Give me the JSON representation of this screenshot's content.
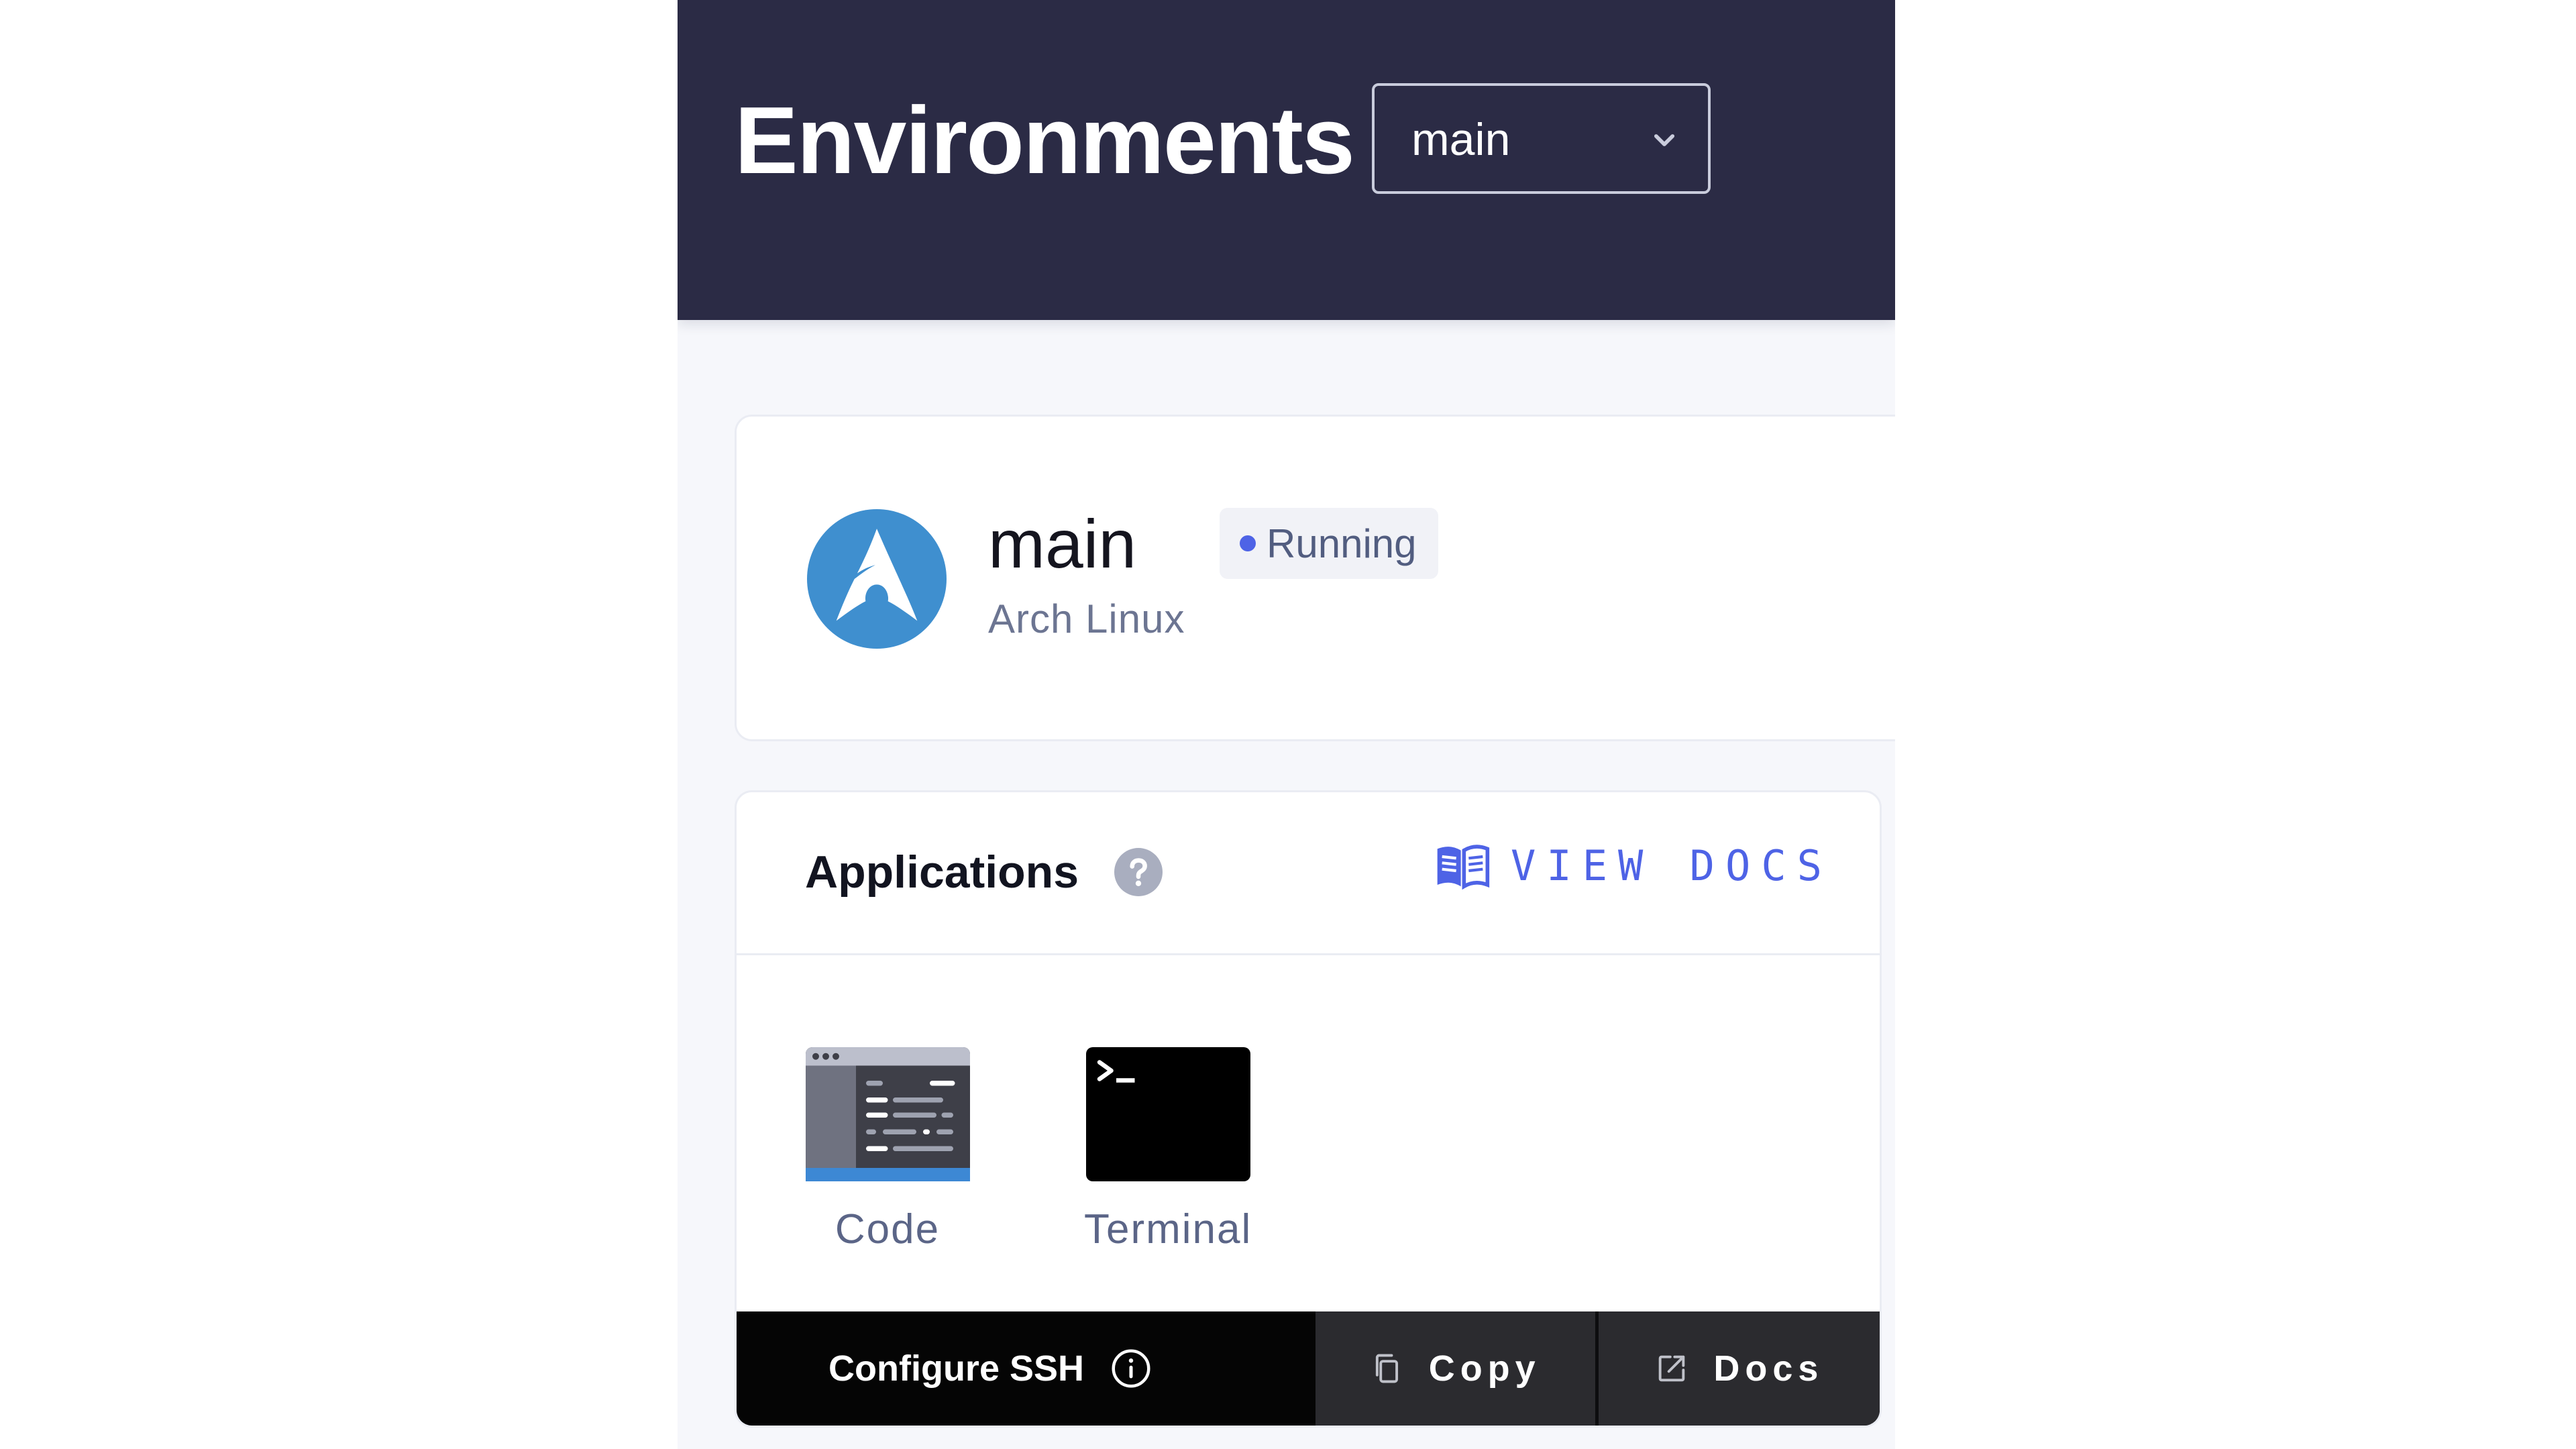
{
  "header": {
    "title": "Environments",
    "environment_select": {
      "value": "main",
      "icon": "chevron-down-icon"
    }
  },
  "environment": {
    "name": "main",
    "status": "Running",
    "status_color": "#4e63e6",
    "os": "Arch Linux",
    "logo_icon": "arch-linux-logo",
    "logo_color": "#3f8fcf"
  },
  "applications": {
    "title": "Applications",
    "help_icon": "question-circle-icon",
    "view_docs_label": "VIEW DOCS",
    "view_docs_icon": "book-icon",
    "accent_color": "#4e63e6",
    "items": [
      {
        "label": "Code",
        "icon": "code-editor-icon"
      },
      {
        "label": "Terminal",
        "icon": "terminal-icon"
      }
    ]
  },
  "ssh": {
    "label": "Configure SSH",
    "info_icon": "info-circle-icon",
    "copy_label": "Copy",
    "copy_icon": "copy-icon",
    "docs_label": "Docs",
    "docs_icon": "external-link-icon"
  },
  "colors": {
    "header_bg": "#2b2b45",
    "page_bg": "#f6f7fb",
    "ssh_bar_bg": "#050505",
    "ssh_button_bg": "#2b2b2f"
  }
}
